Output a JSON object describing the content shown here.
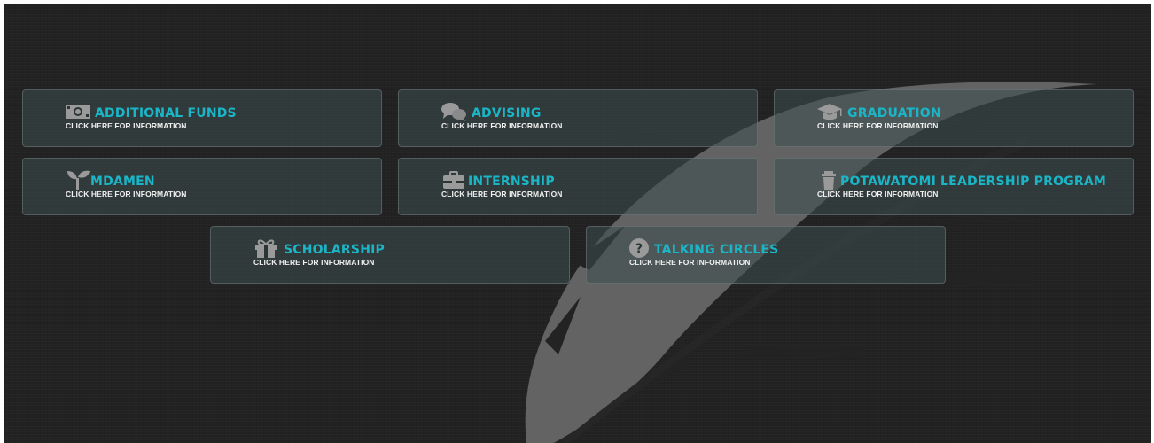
{
  "page": {
    "feather_color": "#6a6a6a",
    "background": "#222222",
    "title_color": "#1ab6c8",
    "subtitle_color": "#f0f0f0",
    "icon_color": "#9a9a9a"
  },
  "buttons": [
    {
      "title": "ADDITIONAL FUNDS",
      "subtitle": "CLICK HERE FOR INFORMATION",
      "icon": "money-icon"
    },
    {
      "title": "ADVISING",
      "subtitle": "CLICK HERE FOR INFORMATION",
      "icon": "chat-bubbles-icon"
    },
    {
      "title": "GRADUATION",
      "subtitle": "CLICK HERE FOR INFORMATION",
      "icon": "graduation-cap-icon"
    },
    {
      "title": "MDAMEN",
      "subtitle": "CLICK HERE FOR INFORMATION",
      "icon": "seedling-icon"
    },
    {
      "title": "INTERNSHIP",
      "subtitle": "CLICK HERE FOR INFORMATION",
      "icon": "briefcase-icon"
    },
    {
      "title": "POTAWATOMI LEADERSHIP PROGRAM",
      "subtitle": "CLICK HERE FOR INFORMATION",
      "icon": "trash-can-icon"
    },
    {
      "title": "SCHOLARSHIP",
      "subtitle": "CLICK HERE FOR INFORMATION",
      "icon": "gift-icon"
    },
    {
      "title": "TALKING CIRCLES",
      "subtitle": "CLICK HERE FOR INFORMATION",
      "icon": "question-circle-icon"
    }
  ]
}
